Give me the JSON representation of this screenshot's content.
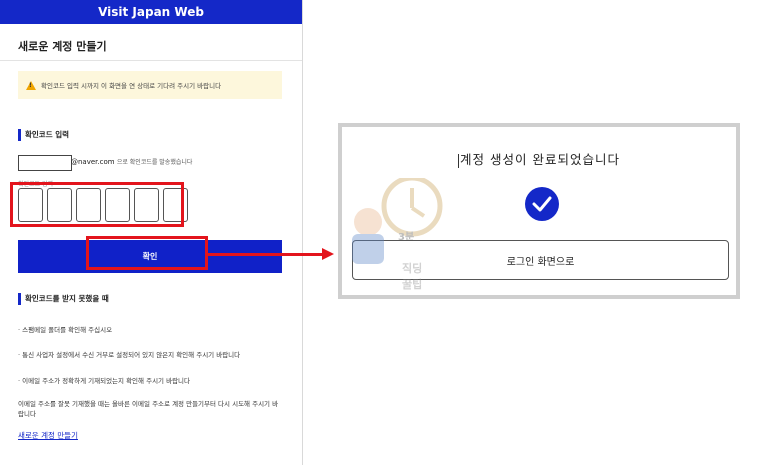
{
  "header": {
    "title": "Visit Japan Web"
  },
  "page": {
    "title": "새로운 계정 만들기"
  },
  "notice": {
    "text": "확인코드 입력 시까지 이 화면을 연 상태로 기다려 주시기 바랍니다"
  },
  "code_section": {
    "title": "확인코드 입력",
    "email_domain": "@naver.com",
    "email_suffix": "으로 확인코드를 발송했습니다",
    "code_label": "확인코드 입력",
    "code_digits": [
      "",
      "",
      "",
      "",
      "",
      ""
    ]
  },
  "confirm_button": {
    "label": "확인"
  },
  "help_section": {
    "title": "확인코드를 받지 못했을 때",
    "bullets": [
      "· 스팸메일 폴더를 확인해 주십시오",
      "· 통신 사업자 설정에서 수신 거부로 설정되어 있지 않은지 확인해 주시기 바랍니다",
      "· 이메일 주소가 정확하게 기재되었는지 확인해 주시기 바랍니다"
    ],
    "last": "이메일 주소를 잘못 기재했을 때는 올바른 이메일 주소로 계정 만들기부터 다시 시도해 주시기 바랍니다"
  },
  "new_account_link": {
    "label": "새로운 계정 만들기"
  },
  "complete_dialog": {
    "title": "계정 생성이 완료되었습니다",
    "button": "로그인 화면으로"
  },
  "watermark": {
    "line1": "3분",
    "line2": "직딩",
    "line3": "꿀팁"
  },
  "colors": {
    "brand_blue": "#1428c8",
    "highlight_red": "#e3141c",
    "notice_bg": "#fdf7dc"
  },
  "icons": [
    "warning-icon",
    "check-icon",
    "arrow-right-icon"
  ]
}
